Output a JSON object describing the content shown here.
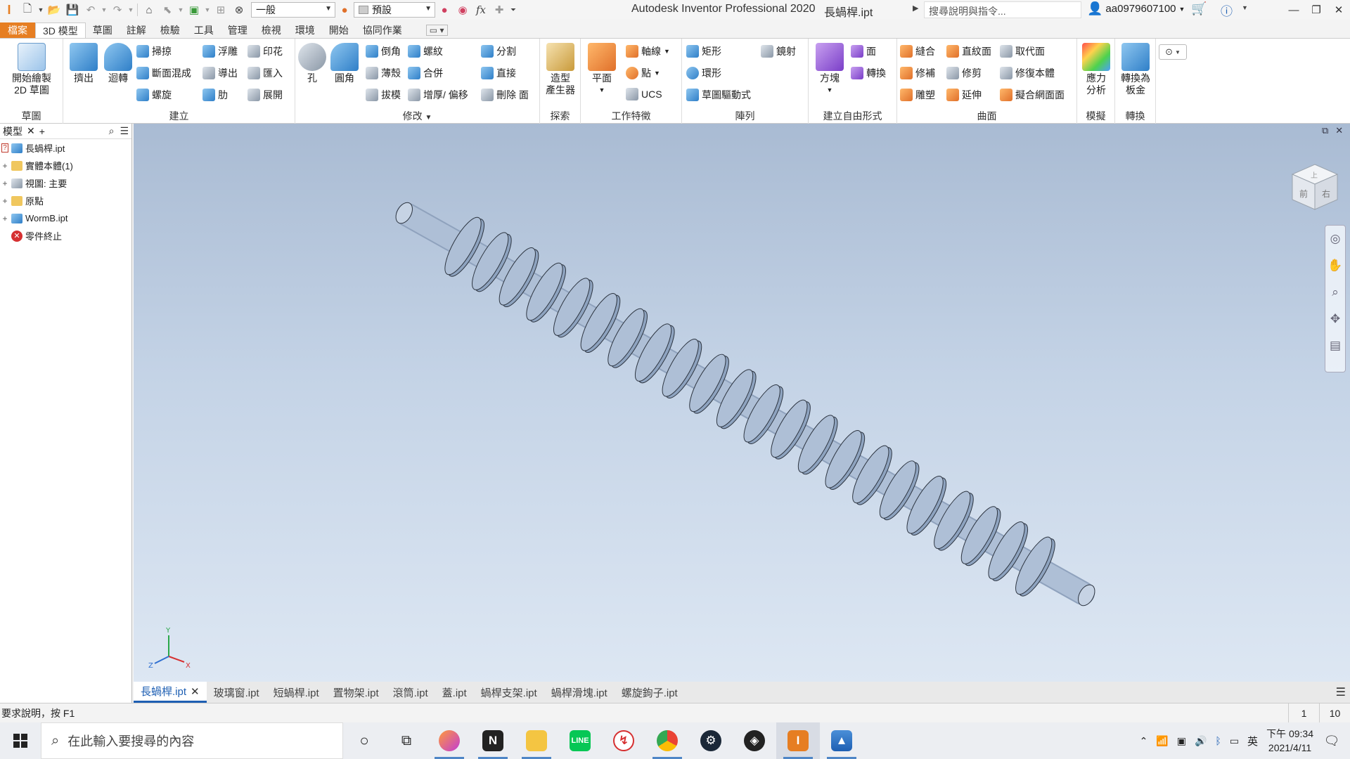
{
  "title_bar": {
    "app_title": "Autodesk Inventor Professional 2020",
    "doc_title": "長蝸桿.ipt",
    "material_select": "一般",
    "appearance_select": "預設",
    "search_placeholder": "搜尋說明與指令...",
    "user_name": "aa0979607100"
  },
  "ribbon_tabs": [
    "檔案",
    "3D 模型",
    "草圖",
    "註解",
    "檢驗",
    "工具",
    "管理",
    "檢視",
    "環境",
    "開始",
    "協同作業"
  ],
  "ribbon": {
    "sketch_panel": {
      "label": "草圖",
      "start_sketch": "開始繪製\n2D 草圖"
    },
    "create_panel": {
      "label": "建立",
      "extrude": "擠出",
      "revolve": "迴轉",
      "sweep": "掃掠",
      "loft": "斷面混成",
      "coil": "螺旋",
      "emboss": "浮雕",
      "derive": "導出",
      "rib": "肋",
      "decal": "印花",
      "import": "匯入",
      "unfold": "展開"
    },
    "modify_panel": {
      "label": "修改",
      "hole": "孔",
      "fillet": "圓角",
      "chamfer": "倒角",
      "shell": "薄殼",
      "draft": "拔模",
      "thread": "螺紋",
      "combine": "合併",
      "thicken": "增厚/ 偏移",
      "split": "分割",
      "direct": "直接",
      "delete_face": "刪除 面"
    },
    "explore_panel": {
      "label": "探索",
      "shape_generator": "造型\n產生器"
    },
    "work_features_panel": {
      "label": "工作特徵",
      "plane": "平面",
      "axis": "軸線",
      "point": "點",
      "ucs": "UCS"
    },
    "pattern_panel": {
      "label": "陣列",
      "rectangular": "矩形",
      "circular": "環形",
      "sketch_driven": "草圖驅動式",
      "mirror": "鏡射"
    },
    "freeform_panel": {
      "label": "建立自由形式",
      "box": "方塊",
      "face": "面",
      "convert": "轉換"
    },
    "surface_panel": {
      "label": "曲面",
      "stitch": "縫合",
      "patch": "修補",
      "sculpt": "雕塑",
      "ruled_surface": "直紋面",
      "trim": "修剪",
      "extend": "延伸",
      "replace_face": "取代面",
      "repair_bodies": "修復本體",
      "fit_mesh_face": "擬合網面面"
    },
    "simulation_panel": {
      "label": "模擬",
      "stress_analysis": "應力\n分析"
    },
    "convert_panel": {
      "label": "轉換",
      "convert_to_sheet_metal": "轉換為\n板金"
    }
  },
  "browser": {
    "title": "模型",
    "tree": [
      {
        "label": "長蝸桿.ipt",
        "expander": "",
        "icon": "part-icon"
      },
      {
        "label": "實體本體(1)",
        "expander": "+",
        "icon": "folder-icon"
      },
      {
        "label": "視圖: 主要",
        "expander": "+",
        "icon": "view-icon"
      },
      {
        "label": "原點",
        "expander": "+",
        "icon": "folder-icon"
      },
      {
        "label": "WormB.ipt",
        "expander": "+",
        "icon": "derived-part-icon"
      },
      {
        "label": "零件終止",
        "expander": "",
        "icon": "end-of-part-icon"
      }
    ]
  },
  "viewcube": {
    "front": "前",
    "right": "右",
    "top": "上"
  },
  "axis_triad": {
    "x": "X",
    "y": "Y",
    "z": "Z"
  },
  "document_tabs": [
    "長蝸桿.ipt",
    "玻璃窗.ipt",
    "短蝸桿.ipt",
    "置物架.ipt",
    "滾筒.ipt",
    "蓋.ipt",
    "蝸桿支架.ipt",
    "蝸桿滑塊.ipt",
    "螺旋鉤子.ipt"
  ],
  "status_bar": {
    "text": "要求說明，按 F1",
    "value1": "1",
    "value2": "10"
  },
  "taskbar": {
    "search_placeholder": "在此輸入要搜尋的內容",
    "apps": [
      "firefox-icon",
      "notion-icon",
      "file-explorer-icon",
      "line-icon",
      "app-icon",
      "chrome-icon",
      "steam-icon",
      "app-icon-2",
      "inventor-icon",
      "photos-icon"
    ],
    "ime": "英",
    "time": "下午 09:34",
    "date": "2021/4/11"
  },
  "colors": {
    "file_tab": "#e67e22",
    "accent_blue": "#1e5fb3",
    "viewport_top": "#a9bbd3",
    "viewport_bottom": "#dde7f3",
    "part_color": "#aebfd6"
  }
}
